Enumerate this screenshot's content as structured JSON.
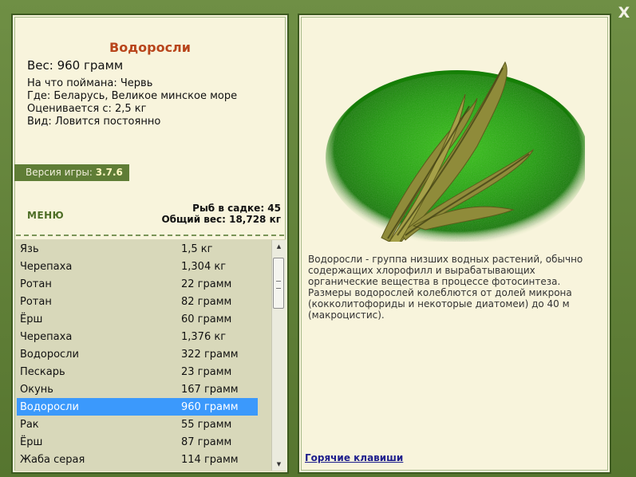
{
  "window": {
    "close_label": "X"
  },
  "fish": {
    "title": "Водоросли",
    "weight": "Вес: 960 грамм",
    "details": [
      "На что поймана: Червь",
      "Где: Беларусь, Великое минское море",
      "Оценивается с: 2,5 кг",
      "Вид: Ловится постоянно"
    ]
  },
  "version": {
    "label": "Версия игры:",
    "value": "3.7.6"
  },
  "menu": {
    "label": "МЕНЮ"
  },
  "cage": {
    "count_text": "Рыб в садке: 45",
    "total_weight_text": "Общий вес: 18,728 кг"
  },
  "catch_list": [
    {
      "name": "Язь",
      "weight": "1,5 кг",
      "selected": false
    },
    {
      "name": "Черепаха",
      "weight": "1,304 кг",
      "selected": false
    },
    {
      "name": "Ротан",
      "weight": "22 грамм",
      "selected": false
    },
    {
      "name": "Ротан",
      "weight": "82 грамм",
      "selected": false
    },
    {
      "name": "Ёрш",
      "weight": "60 грамм",
      "selected": false
    },
    {
      "name": "Черепаха",
      "weight": "1,376 кг",
      "selected": false
    },
    {
      "name": "Водоросли",
      "weight": "322 грамм",
      "selected": false
    },
    {
      "name": "Пескарь",
      "weight": "23 грамм",
      "selected": false
    },
    {
      "name": "Окунь",
      "weight": "167 грамм",
      "selected": false
    },
    {
      "name": "Водоросли",
      "weight": "960 грамм",
      "selected": true
    },
    {
      "name": "Рак",
      "weight": "55 грамм",
      "selected": false
    },
    {
      "name": "Ёрш",
      "weight": "87 грамм",
      "selected": false
    },
    {
      "name": "Жаба серая",
      "weight": "114 грамм",
      "selected": false
    }
  ],
  "scrollbar": {
    "up_glyph": "▲",
    "down_glyph": "▼"
  },
  "description": "Водоросли - группа низших водных растений, обычно содержащих хлорофилл и вырабатывающих органические вещества в процессе фотосинтеза. Размеры водорослей колеблются от долей микрона (кокколитофориды и некоторые диатомеи) до 40 м (макроцистис).",
  "hotkeys": {
    "label": "Горячие клавиши"
  },
  "colors": {
    "frame": "#5b7b36",
    "panel_bg": "#f8f4dc",
    "title": "#b8451b",
    "list_bg": "#d8d8ba",
    "selected_row": "#3b99fc",
    "link": "#1d1d8c"
  }
}
